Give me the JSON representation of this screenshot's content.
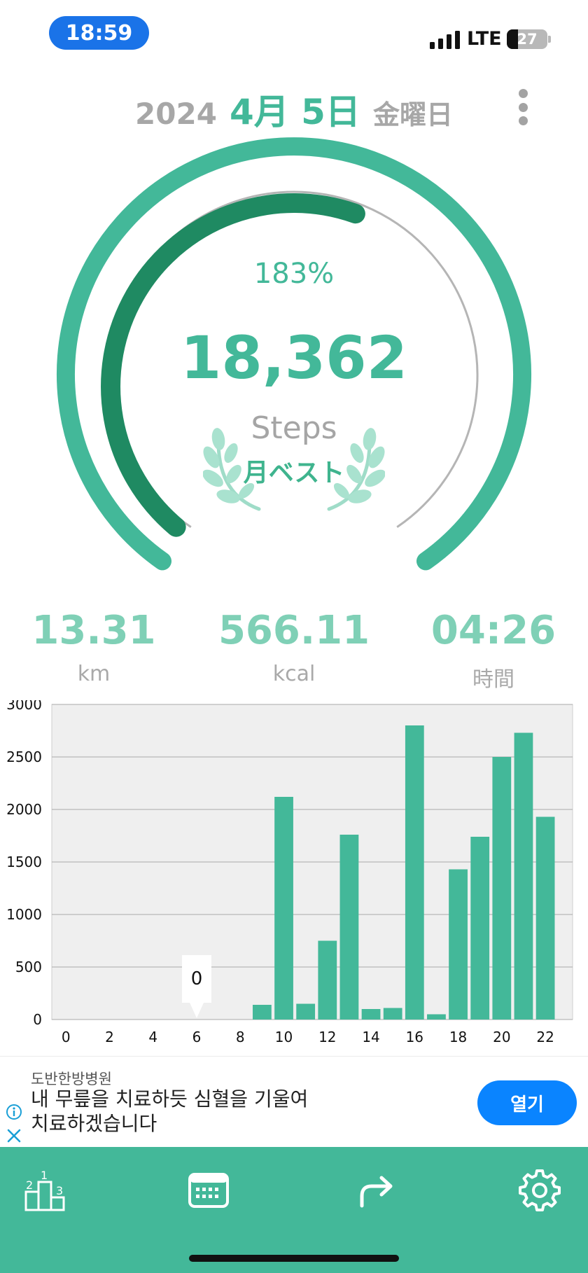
{
  "status_bar": {
    "time": "18:59",
    "network": "LTE",
    "battery_level": "27",
    "battery_fraction": 0.27
  },
  "date": {
    "year": "2024",
    "month_day": "4月 5日",
    "weekday": "金曜日"
  },
  "gauge": {
    "percent_label": "183%",
    "steps": "18,362",
    "steps_label": "Steps",
    "badge": "月ベスト",
    "inner_ring_fraction": 0.57
  },
  "stats": {
    "distance": {
      "value": "13.31",
      "unit": "km"
    },
    "calories": {
      "value": "566.11",
      "unit": "kcal"
    },
    "duration": {
      "value": "04:26",
      "unit": "時間"
    }
  },
  "chart_data": {
    "type": "bar",
    "x": [
      0,
      1,
      2,
      3,
      4,
      5,
      6,
      7,
      8,
      9,
      10,
      11,
      12,
      13,
      14,
      15,
      16,
      17,
      18,
      19,
      20,
      21,
      22
    ],
    "values": [
      0,
      0,
      0,
      0,
      0,
      0,
      0,
      0,
      0,
      140,
      2120,
      150,
      750,
      1760,
      100,
      110,
      2800,
      50,
      1430,
      1740,
      2500,
      2730,
      1930
    ],
    "xticks": [
      "0",
      "2",
      "4",
      "6",
      "8",
      "10",
      "12",
      "14",
      "16",
      "18",
      "20",
      "22"
    ],
    "yticks": [
      "0",
      "500",
      "1000",
      "1500",
      "2000",
      "2500",
      "3000"
    ],
    "ylim": [
      0,
      3000
    ],
    "grid": true,
    "tooltip": {
      "x": 6,
      "label": "0"
    },
    "bar_color": "#43b899"
  },
  "ad": {
    "advertiser": "도반한방병원",
    "text_line1": "내 무릎을 치료하듯 심혈을 기울여",
    "text_line2": "치료하겠습니다",
    "open_label": "열기"
  },
  "tabs": [
    {
      "name": "ranking",
      "icon": "podium-icon"
    },
    {
      "name": "calendar",
      "icon": "calendar-icon"
    },
    {
      "name": "share",
      "icon": "share-icon"
    },
    {
      "name": "settings",
      "icon": "gear-icon"
    }
  ],
  "colors": {
    "accent": "#43b899",
    "accent_dark": "#1f8a62",
    "ad_button": "#0a84ff",
    "status_pill": "#1a73e8"
  }
}
